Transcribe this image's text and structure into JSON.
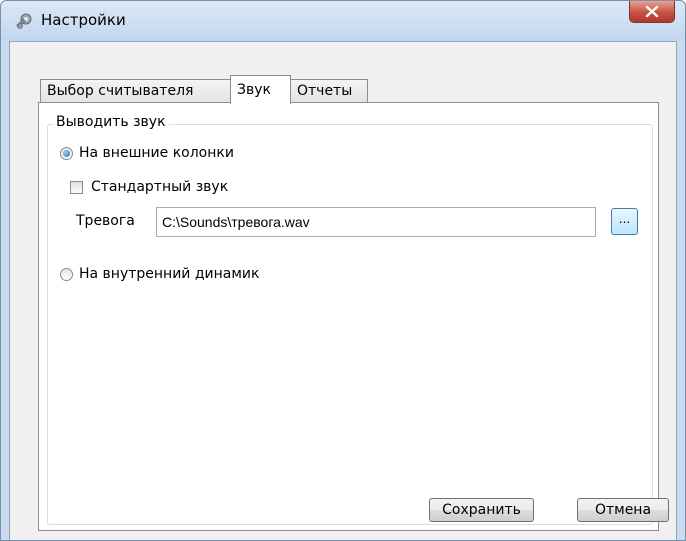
{
  "window": {
    "title": "Настройки",
    "app_icon": "gear-icon",
    "close_icon": "close-icon"
  },
  "tabs": [
    {
      "label": "Выбор считывателя",
      "active": false
    },
    {
      "label": "Звук",
      "active": true
    },
    {
      "label": "Отчеты",
      "active": false
    }
  ],
  "sound": {
    "group_label": "Выводить звук",
    "external_speakers": {
      "label": "На внешние колонки",
      "checked": true
    },
    "standard_sound": {
      "label": "Стандартный звук",
      "checked": false
    },
    "alarm": {
      "label": "Тревога",
      "value": "C:\\Sounds\\тревога.wav",
      "browse_label": "..."
    },
    "internal_speaker": {
      "label": "На внутренний динамик",
      "checked": false
    }
  },
  "buttons": {
    "save": "Сохранить",
    "cancel": "Отмена"
  }
}
